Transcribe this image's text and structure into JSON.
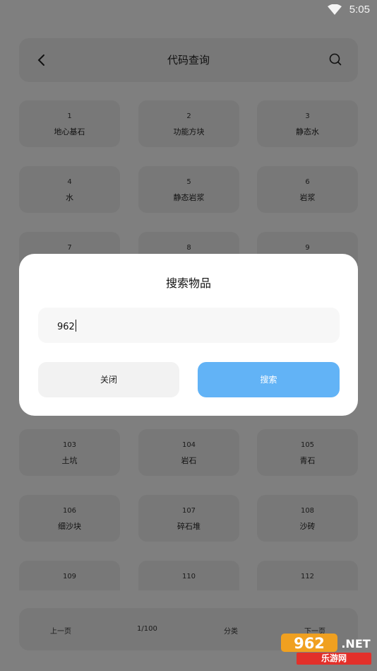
{
  "status_bar": {
    "time": "5:05",
    "wifi_icon": "wifi-icon"
  },
  "header": {
    "title": "代码查询",
    "back_icon": "chevron-left-icon",
    "search_icon": "search-icon"
  },
  "grid": [
    {
      "num": "1",
      "name": "地心基石"
    },
    {
      "num": "2",
      "name": "功能方块"
    },
    {
      "num": "3",
      "name": "静态水"
    },
    {
      "num": "4",
      "name": "水"
    },
    {
      "num": "5",
      "name": "静态岩浆"
    },
    {
      "num": "6",
      "name": "岩浆"
    },
    {
      "num": "7",
      "name": ""
    },
    {
      "num": "8",
      "name": ""
    },
    {
      "num": "9",
      "name": ""
    },
    {
      "num": "103",
      "name": "土坑"
    },
    {
      "num": "104",
      "name": "岩石"
    },
    {
      "num": "105",
      "name": "青石"
    },
    {
      "num": "106",
      "name": "细沙块"
    },
    {
      "num": "107",
      "name": "碎石堆"
    },
    {
      "num": "108",
      "name": "沙砖"
    },
    {
      "num": "109",
      "name": ""
    },
    {
      "num": "110",
      "name": ""
    },
    {
      "num": "112",
      "name": ""
    }
  ],
  "pager": {
    "prev": "上一页",
    "page": "1/100",
    "category": "分类",
    "next": "下一页"
  },
  "dialog": {
    "title": "搜索物品",
    "input_value": "962",
    "close_label": "关闭",
    "search_label": "搜索",
    "search_color": "#62b3f6"
  },
  "watermark": {
    "logo_text": "962.NET",
    "site": "乐游网"
  }
}
